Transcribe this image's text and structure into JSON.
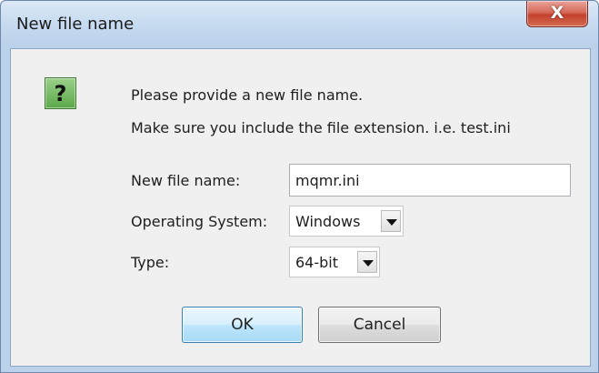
{
  "window": {
    "title": "New file name",
    "close_label": "X"
  },
  "icon": {
    "name": "help-icon",
    "glyph": "?",
    "color": "#5ba84a"
  },
  "message": {
    "line1": "Please provide a new file name.",
    "line2": "Make sure you include the file extension. i.e. test.ini"
  },
  "form": {
    "file_name_label": "New file name:",
    "file_name_value": "mqmr.ini",
    "os_label": "Operating System:",
    "os_value": "Windows",
    "type_label": "Type:",
    "type_value": "64-bit"
  },
  "buttons": {
    "ok": "OK",
    "cancel": "Cancel"
  },
  "colors": {
    "titlebar": "#c6daf0",
    "close_button": "#c4412e",
    "ok_border": "#3c7fb1"
  }
}
